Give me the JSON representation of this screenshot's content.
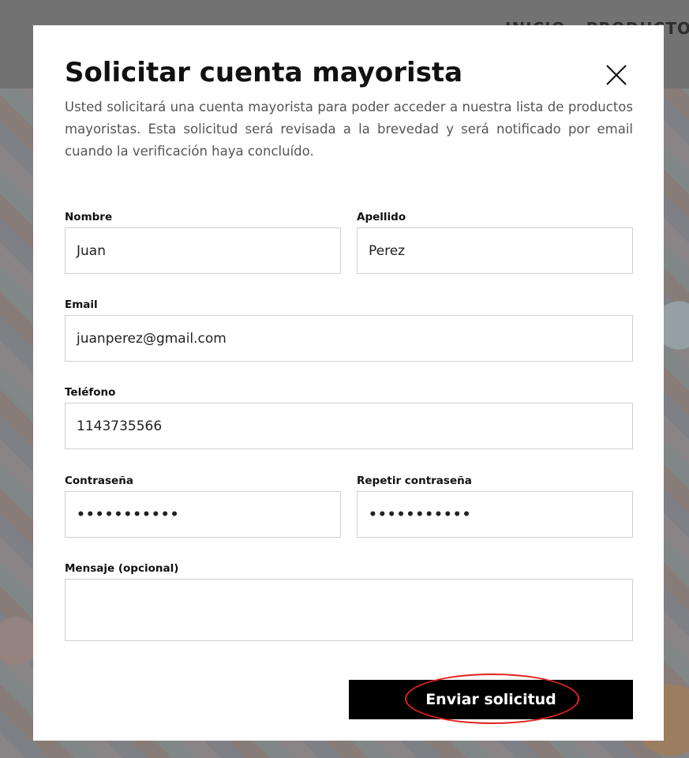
{
  "background": {
    "nav_items": [
      "INICIO",
      "PRODUCTOS"
    ]
  },
  "modal": {
    "title": "Solicitar cuenta mayorista",
    "description": "Usted solicitará una cuenta mayorista para poder acceder a nuestra lista de productos mayoristas. Esta solicitud será revisada a la brevedad y será notificado por email cuando la verificación haya concluído.",
    "close_icon": "close-icon",
    "fields": {
      "nombre": {
        "label": "Nombre",
        "value": "Juan"
      },
      "apellido": {
        "label": "Apellido",
        "value": "Perez"
      },
      "email": {
        "label": "Email",
        "value": "juanperez@gmail.com"
      },
      "telefono": {
        "label": "Teléfono",
        "value": "1143735566"
      },
      "contrasena": {
        "label": "Contraseña",
        "value": "•••••••••••"
      },
      "repetir_contrasena": {
        "label": "Repetir contraseña",
        "value": "•••••••••••"
      },
      "mensaje": {
        "label": "Mensaje (opcional)",
        "value": ""
      }
    },
    "submit_label": "Enviar solicitud",
    "highlight_color": "#e2221c"
  }
}
